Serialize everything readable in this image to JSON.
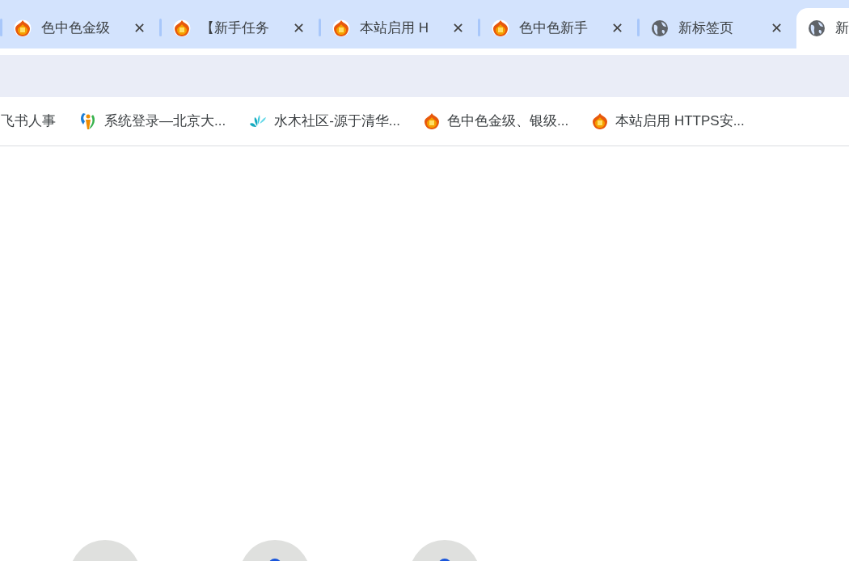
{
  "tabs": [
    {
      "title": "色中色金级",
      "kind": "flame",
      "selected": false
    },
    {
      "title": "【新手任务",
      "kind": "flame",
      "selected": false
    },
    {
      "title": "本站启用 H",
      "kind": "flame",
      "selected": false
    },
    {
      "title": "色中色新手",
      "kind": "flame",
      "selected": false
    },
    {
      "title": "新标签页",
      "kind": "globe",
      "selected": false
    },
    {
      "title": "新",
      "kind": "globe",
      "selected": true
    }
  ],
  "close_glyph": "✕",
  "bookmarks": [
    {
      "title": "飞书人事",
      "kind": "plain"
    },
    {
      "title": "系统登录—北京大...",
      "kind": "person"
    },
    {
      "title": "水木社区-源于清华...",
      "kind": "splash"
    },
    {
      "title": "色中色金级、银级...",
      "kind": "flame"
    },
    {
      "title": "本站启用 HTTPS安...",
      "kind": "flame"
    }
  ],
  "shortcuts": [
    {
      "kind": "blank"
    },
    {
      "kind": "icon"
    },
    {
      "kind": "icon"
    }
  ]
}
